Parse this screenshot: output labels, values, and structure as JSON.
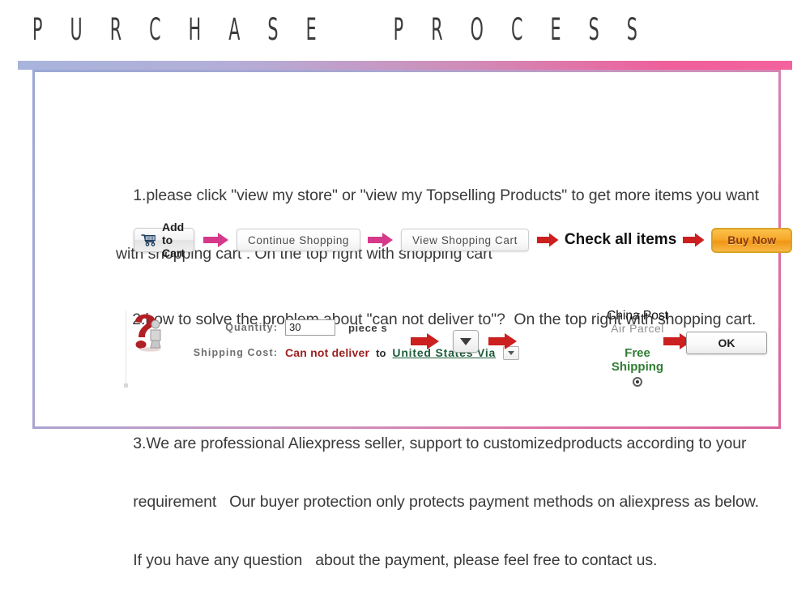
{
  "header": {
    "title": "P U R C H A S E    P R O C E S S"
  },
  "colors": {
    "gradient_start": "#a8b4dc",
    "gradient_end": "#f4639e",
    "buy_now_orange": "#f7a92c",
    "free_shipping_green": "#2f7d32",
    "error_red": "#9c1f1f",
    "link_green": "#1d5c3a",
    "arrow_pink": "#d6398a",
    "arrow_red": "#cc1f1f"
  },
  "steps": {
    "one": {
      "line1": "1.please click \"view my store\" or \"view my Topselling Products\" to get more items you want",
      "line2": "with shopping cart . On the top right with shopping cart"
    },
    "two": {
      "line1": "2.how to solve the problem about \"can not deliver to\"?  On the top right with shopping cart."
    },
    "three": {
      "line1": "3.We are professional Aliexpress seller, support to customizedproducts according to your",
      "line2": "requirement   Our buyer protection only protects payment methods on aliexpress as below.",
      "line3": "If you have any question   about the payment, please feel free to contact us."
    }
  },
  "cart_flow": {
    "add_to_cart": "Add to Cart",
    "continue_shopping": "Continue Shopping",
    "view_shopping_cart": "View Shopping Cart",
    "check_all_items": "Check all items",
    "buy_now": "Buy Now"
  },
  "shipping_form": {
    "quantity_label": "Quantity:",
    "quantity_value": "30",
    "quantity_unit": "piece s",
    "shipping_cost_label": "Shipping Cost:",
    "cannot_deliver": "Can not deliver",
    "to": "to",
    "destination": "United States Via",
    "carrier_line1": "China Post",
    "carrier_line2": "Air Parcel",
    "free_shipping_line1": "Free",
    "free_shipping_line2": "Shipping",
    "ok_button": "OK"
  }
}
